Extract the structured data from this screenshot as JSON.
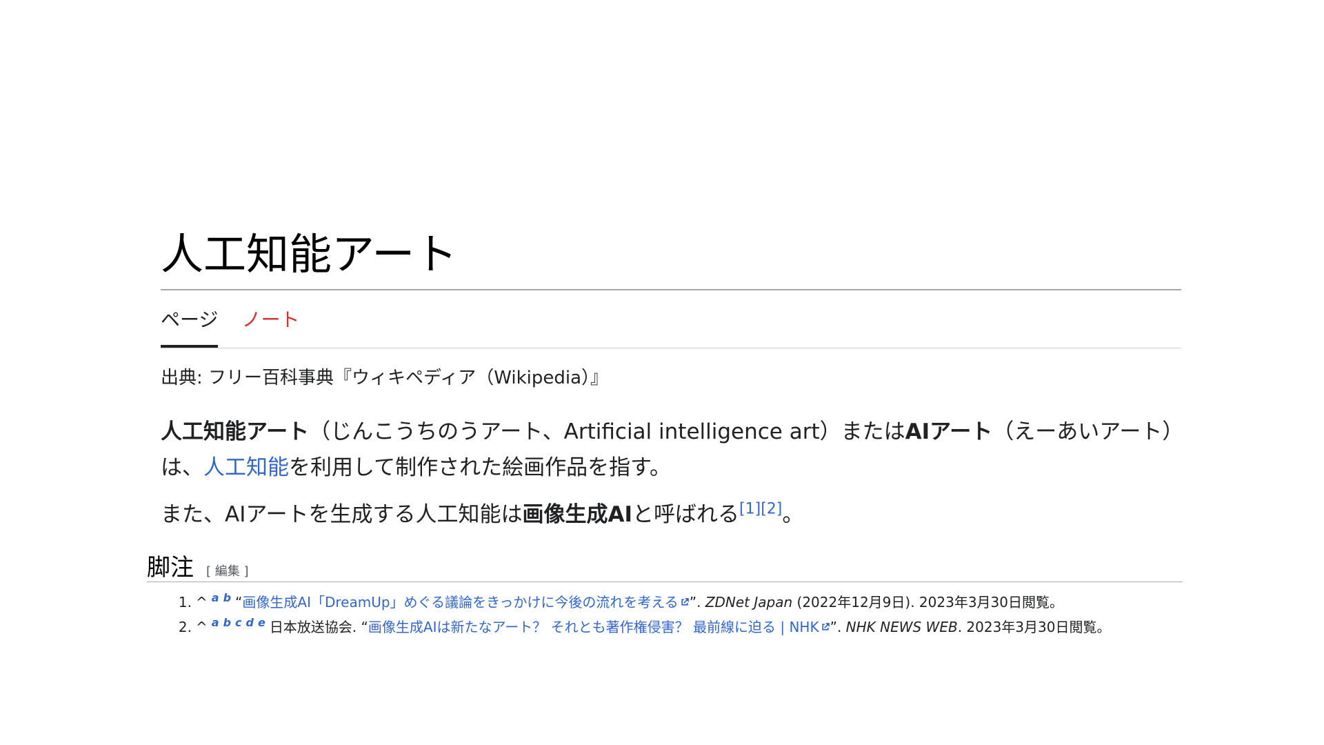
{
  "page": {
    "title": "人工知能アート",
    "tabs": [
      {
        "label": "ページ",
        "active": true
      },
      {
        "label": "ノート",
        "active": false
      }
    ],
    "source": "出典: フリー百科事典『ウィキペディア（Wikipedia）』"
  },
  "article": {
    "p1": {
      "bold1": "人工知能アート",
      "text1": "（じんこうちのうアート、Artificial intelligence art）または",
      "bold2": "AIアート",
      "text2": "（えーあいアート）は、",
      "link1": "人工知能",
      "text3": "を利用して制作された絵画作品を指す。"
    },
    "p2": {
      "text1": "また、AIアートを生成する人工知能は",
      "bold1": "画像生成AI",
      "text2": "と呼ばれる",
      "ref1": "[1]",
      "ref2": "[2]",
      "text3": "。"
    }
  },
  "footnotes": {
    "heading": "脚注",
    "edit": "[ 編集 ]",
    "items": [
      {
        "number": "1.",
        "caret": "^",
        "backlinks": [
          "a",
          "b"
        ],
        "pre": "",
        "open_quote": "“",
        "link": "画像生成AI「DreamUp」めぐる議論をきっかけに今後の流れを考える",
        "close_quote": "”. ",
        "publisher": "ZDNet Japan",
        "tail": " (2022年12月9日). 2023年3月30日閲覧。"
      },
      {
        "number": "2.",
        "caret": "^",
        "backlinks": [
          "a",
          "b",
          "c",
          "d",
          "e"
        ],
        "pre": "日本放送協会. ",
        "open_quote": "“",
        "link": "画像生成AIは新たなアート？ それとも著作権侵害？ 最前線に迫る | NHK",
        "close_quote": "”. ",
        "publisher": "NHK NEWS WEB",
        "tail": ". 2023年3月30日閲覧。"
      }
    ]
  },
  "icons": {
    "external_link": "external-link-icon"
  },
  "colors": {
    "link": "#3366cc",
    "redlink": "#d73333",
    "text": "#202122"
  }
}
